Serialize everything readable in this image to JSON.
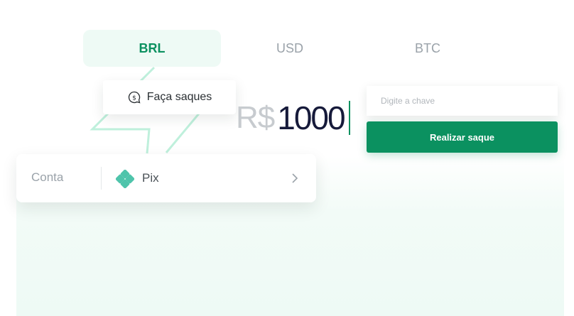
{
  "tabs": [
    {
      "label": "BRL",
      "active": true
    },
    {
      "label": "USD",
      "active": false
    },
    {
      "label": "BTC",
      "active": false
    }
  ],
  "promo": {
    "label": "Faça saques",
    "icon": "dollar-coin-chat-icon"
  },
  "amount": {
    "currency": "R$",
    "value": "1000"
  },
  "key_input": {
    "placeholder": "Digite a chave",
    "value": ""
  },
  "submit": {
    "label": "Realizar saque"
  },
  "account": {
    "label": "Conta",
    "method": "Pix",
    "method_icon": "pix-icon",
    "action_icon": "chevron-right-icon"
  },
  "colors": {
    "accent": "#0b9160",
    "accent_light": "#eefaf5",
    "amount_text": "#161a3a",
    "muted": "#9aa2a9"
  }
}
